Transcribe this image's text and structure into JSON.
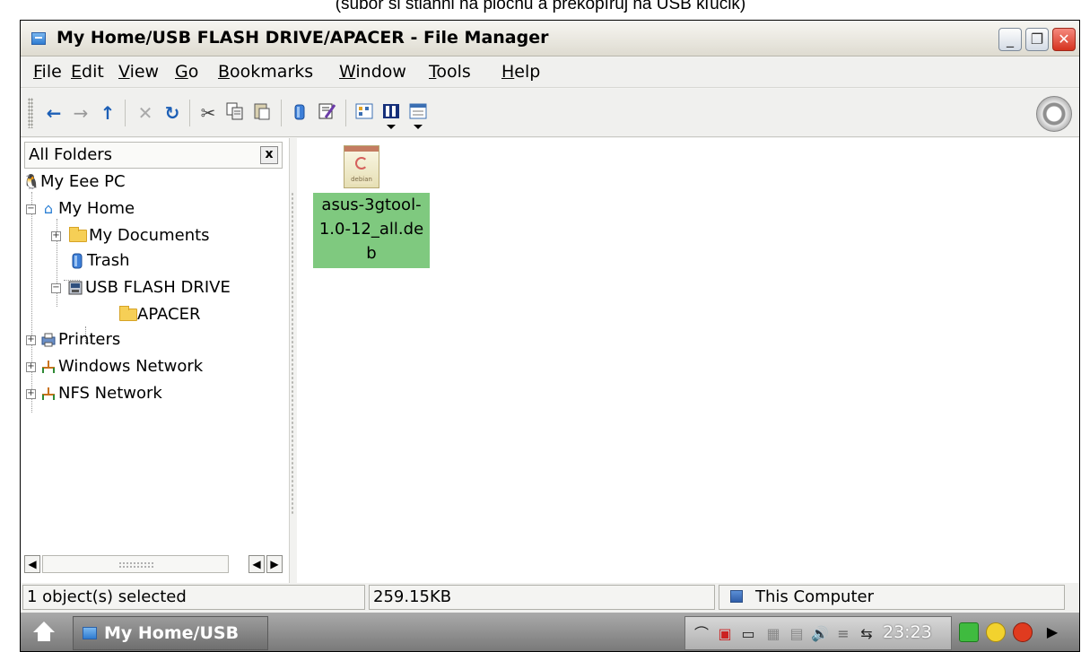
{
  "caption": "(súbor si stiahni na plochu a prekopíruj na USB kľúčik)",
  "window": {
    "title": "My Home/USB FLASH DRIVE/APACER - File Manager",
    "buttons": {
      "minimize": "_",
      "maximize": "❐",
      "close": "✕"
    }
  },
  "menu": [
    "File",
    "Edit",
    "View",
    "Go",
    "Bookmarks",
    "Window",
    "Tools",
    "Help"
  ],
  "toolbar": {
    "icons": [
      "back-icon",
      "forward-icon",
      "up-icon",
      "stop-icon",
      "reload-icon",
      "cut-icon",
      "copy-icon",
      "paste-icon",
      "trash-icon",
      "properties-icon",
      "view-icons-icon",
      "view-list-icon",
      "view-detail-icon"
    ],
    "glyphs": {
      "back": "←",
      "forward": "→",
      "up": "↑",
      "stop": "✕",
      "reload": "↻",
      "cut": "✂"
    }
  },
  "sidebar": {
    "header": "All Folders",
    "close": "x",
    "tree": [
      {
        "label": "My Eee PC"
      },
      {
        "label": "My Home"
      },
      {
        "label": "My Documents"
      },
      {
        "label": "Trash"
      },
      {
        "label": "USB FLASH DRIVE"
      },
      {
        "label": "APACER"
      },
      {
        "label": "Printers"
      },
      {
        "label": "Windows Network"
      },
      {
        "label": "NFS Network"
      }
    ]
  },
  "files": [
    {
      "name": "asus-3gtool-1.0-12_all.deb",
      "icon_text": "debian",
      "selected": true
    }
  ],
  "statusbar": {
    "selection": "1 object(s) selected",
    "size": "259.15KB",
    "location": "This Computer"
  },
  "taskbar": {
    "task": "My Home/USB",
    "clock": "23:23"
  },
  "colors": {
    "selection": "#7fc97f",
    "taskbar": "#8a8a8a"
  }
}
